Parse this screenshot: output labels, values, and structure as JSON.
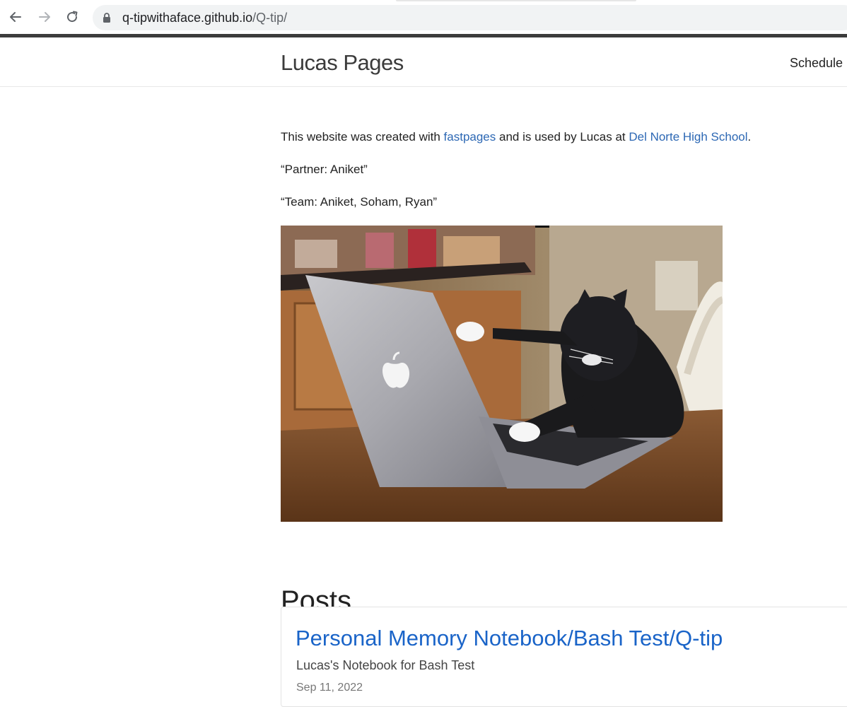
{
  "browser": {
    "url_host": "q-tipwithaface.github.io",
    "url_path": "/Q-tip/",
    "icons": [
      "back-arrow-icon",
      "forward-arrow-icon",
      "reload-icon",
      "lock-icon"
    ]
  },
  "header": {
    "site_title": "Lucas Pages",
    "nav_links": [
      "Schedule"
    ]
  },
  "main": {
    "intro_prefix": "This website was created with ",
    "intro_link1": "fastpages",
    "intro_middle": " and is used by Lucas at ",
    "intro_link2": "Del Norte High School",
    "intro_suffix": ".",
    "partner": "“Partner: Aniket”",
    "team": "“Team: Aniket, Soham, Ryan”",
    "posts_heading": "Posts"
  },
  "posts": [
    {
      "title": "Personal Memory Notebook/Bash Test/Q-tip",
      "description": "Lucas's Notebook for Bash Test",
      "date": "Sep 11, 2022"
    }
  ],
  "colors": {
    "link": "#2d68b4",
    "post_title": "#1a64c8",
    "chrome_divider": "#3c3c3c"
  }
}
